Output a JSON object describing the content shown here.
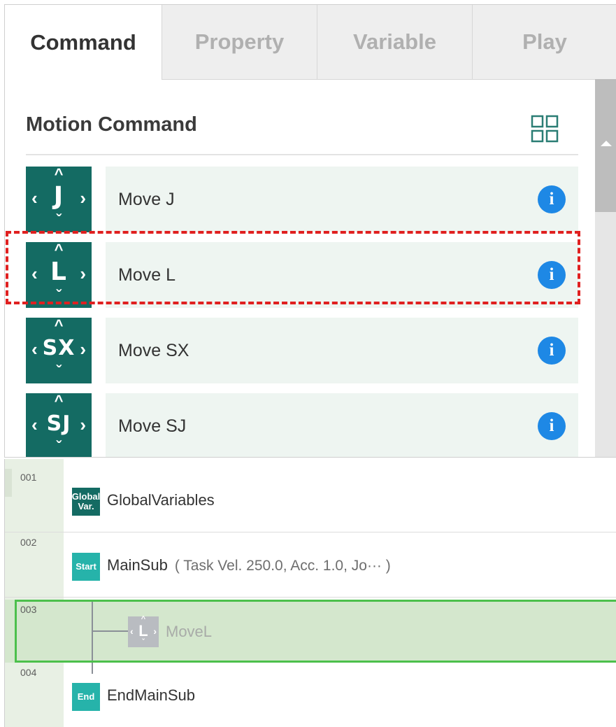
{
  "tabs": [
    {
      "label": "Command",
      "active": true
    },
    {
      "label": "Property",
      "active": false
    },
    {
      "label": "Variable",
      "active": false
    },
    {
      "label": "Play",
      "active": false
    }
  ],
  "section": {
    "title": "Motion Command",
    "view_icon": "grid-view-icon"
  },
  "commands": [
    {
      "icon_text": "J",
      "label": "Move J",
      "info_icon": "i"
    },
    {
      "icon_text": "L",
      "label": "Move L",
      "info_icon": "i"
    },
    {
      "icon_text": "SX",
      "label": "Move SX",
      "info_icon": "i"
    },
    {
      "icon_text": "SJ",
      "label": "Move SJ",
      "info_icon": "i"
    }
  ],
  "highlighted_command": "Move L",
  "program": [
    {
      "line": "001",
      "icon_text": "Global Var.",
      "label": "GlobalVariables",
      "params": "",
      "icon_color": "#146b63"
    },
    {
      "line": "002",
      "icon_text": "Start",
      "label": "MainSub",
      "params": "( Task Vel. 250.0, Acc. 1.0, Jo··· )",
      "icon_color": "#26b3aa"
    },
    {
      "line": "003",
      "icon_text": "L",
      "label": "MoveL",
      "params": "",
      "icon_color": "#b9bcc1",
      "selected": true
    },
    {
      "line": "004",
      "icon_text": "End",
      "label": "EndMainSub",
      "params": "",
      "icon_color": "#26b3aa"
    }
  ],
  "colors": {
    "command_icon": "#146b63",
    "command_body": "#eef5f1",
    "info": "#1e88e5",
    "highlight_dash": "#e02020",
    "selection_border": "#4cc04c",
    "selection_fill": "#d4e7cd"
  }
}
